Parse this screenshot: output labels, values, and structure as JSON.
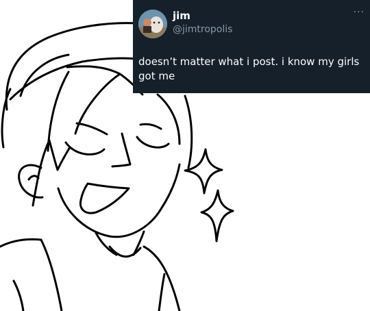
{
  "tweet": {
    "name": "jim",
    "handle": "@jimtropolis",
    "more_icon": "···",
    "text": "doesn’t matter what i post. i know my girls got me"
  },
  "colors": {
    "card_background": "#15202b",
    "name_text": "#ffffff",
    "handle_text": "#8899a6",
    "body_text": "#ffffff",
    "line_art": "#000000"
  },
  "icons": {
    "avatar": "avatar-photo",
    "more": "more-dots-icon",
    "sparkles": "sparkle-icon"
  }
}
